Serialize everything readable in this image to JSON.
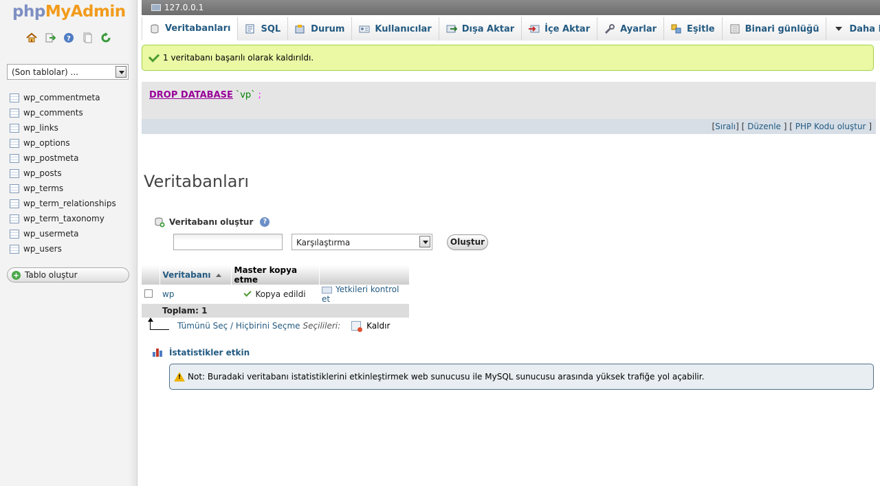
{
  "logo": {
    "php": "php",
    "myadmin": "MyAdmin"
  },
  "navigation": {
    "recent_tables_placeholder": "(Son tablolar) ...",
    "tables": [
      "wp_commentmeta",
      "wp_comments",
      "wp_links",
      "wp_options",
      "wp_postmeta",
      "wp_posts",
      "wp_terms",
      "wp_term_relationships",
      "wp_term_taxonomy",
      "wp_usermeta",
      "wp_users"
    ],
    "create_table_label": "Tablo oluştur"
  },
  "server": {
    "name": "127.0.0.1"
  },
  "tabs": [
    {
      "label": "Veritabanları",
      "icon": "database-icon",
      "active": true
    },
    {
      "label": "SQL",
      "icon": "sql-icon"
    },
    {
      "label": "Durum",
      "icon": "status-icon"
    },
    {
      "label": "Kullanıcılar",
      "icon": "users-icon"
    },
    {
      "label": "Dışa Aktar",
      "icon": "export-icon"
    },
    {
      "label": "İçe Aktar",
      "icon": "import-icon"
    },
    {
      "label": "Ayarlar",
      "icon": "wrench-icon"
    },
    {
      "label": "Eşitle",
      "icon": "sync-icon"
    },
    {
      "label": "Binari günlüğü",
      "icon": "binlog-icon"
    },
    {
      "label": "Daha Fazla",
      "icon": "triangle-down-icon"
    }
  ],
  "messages": {
    "success": "1 veritabanı başarılı olarak kaldırıldı."
  },
  "sql": {
    "keyword": "DROP DATABASE",
    "identifier": "`vp`",
    "terminator": ";"
  },
  "sql_actions": {
    "inline": "Sıralı",
    "edit": "Düzenle",
    "php_code": "PHP Kodu oluştur"
  },
  "page_title": "Veritabanları",
  "create_db": {
    "label": "Veritabanı oluştur",
    "name_value": "",
    "collation_selected": "Karşılaştırma",
    "button": "Oluştur"
  },
  "db_table": {
    "headers": [
      "Veritabanı",
      "Master kopya etme"
    ],
    "rows": [
      {
        "name": "wp",
        "replication": "Kopya edildi",
        "privileges": "Yetkileri kontrol et"
      }
    ],
    "total_label": "Toplam: 1"
  },
  "bulk": {
    "select_all": "Tümünü Seç",
    "separator": "/",
    "select_none": "Hiçbirini Seçme",
    "with_selected": "Seçilileri:",
    "drop": "Kaldır"
  },
  "stats": {
    "enable_label": "İstatistikler etkin"
  },
  "notice": {
    "text": "Not: Buradaki veritabanı istatistiklerini etkinleştirmek web sunucusu ile MySQL sunucusu arasında yüksek trafiğe yol açabilir."
  },
  "colors": {
    "link": "#235a81",
    "success_bg": "#ebf8a4",
    "notice_bg": "#e8eef1",
    "logo_php": "#7e8fc3",
    "logo_admin": "#f29b1b"
  }
}
